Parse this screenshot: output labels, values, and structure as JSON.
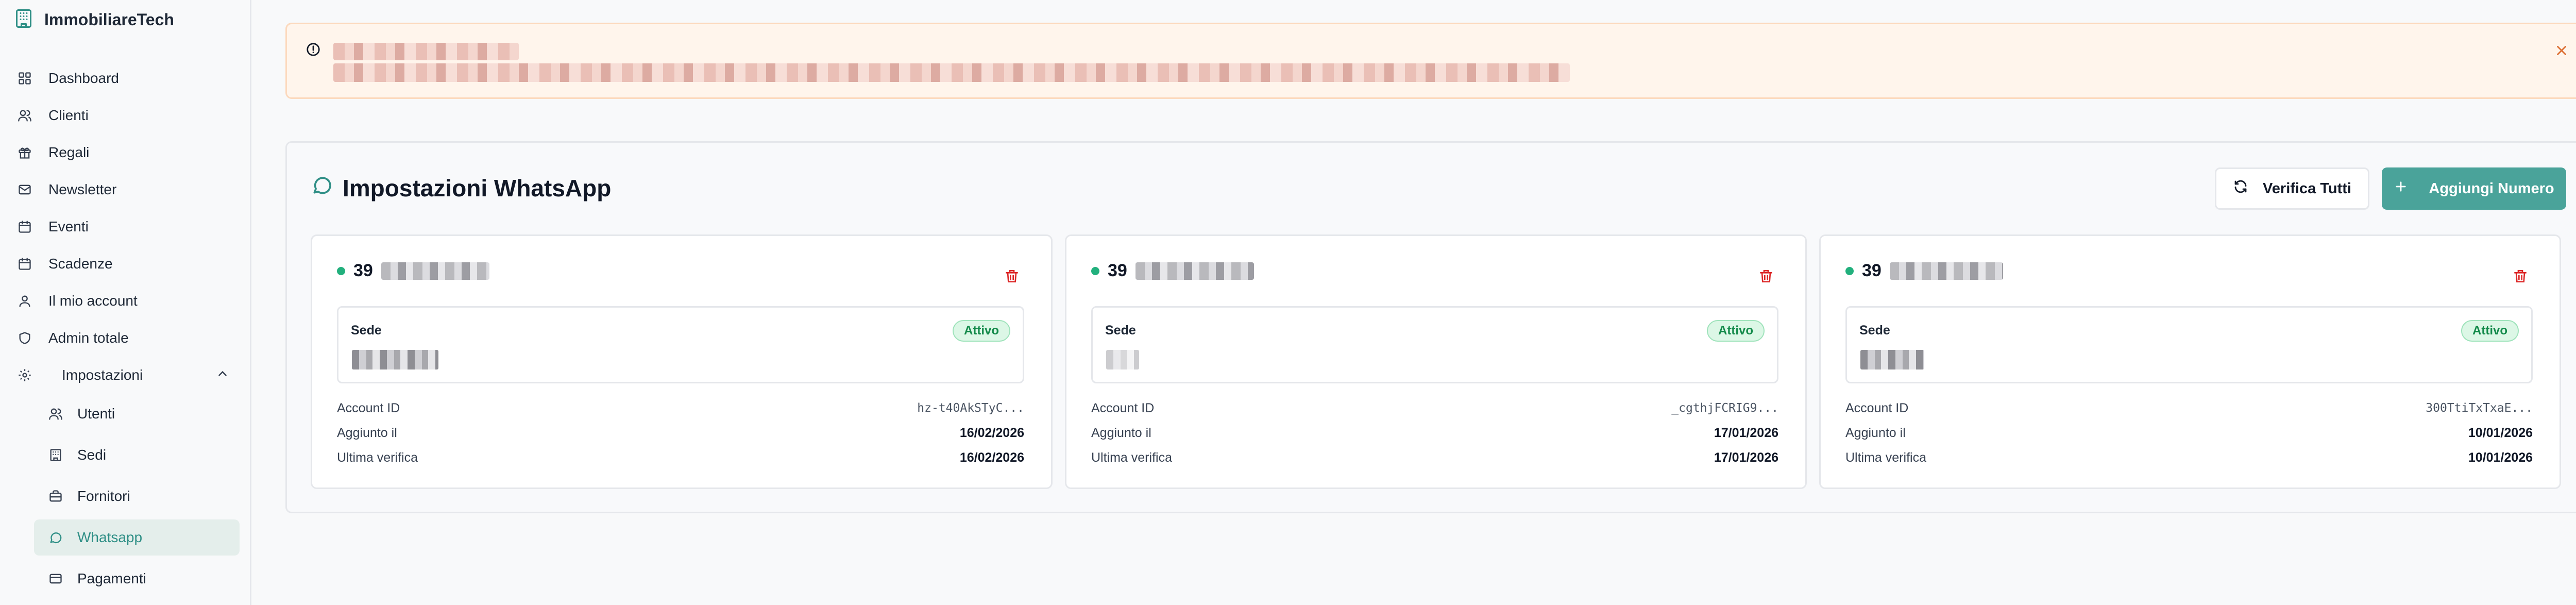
{
  "brand": {
    "name": "ImmobiliareTech",
    "logo_icon": "building-icon"
  },
  "sidebar": {
    "items": [
      {
        "label": "Dashboard",
        "icon": "grid-icon"
      },
      {
        "label": "Clienti",
        "icon": "users-icon"
      },
      {
        "label": "Regali",
        "icon": "gift-icon"
      },
      {
        "label": "Newsletter",
        "icon": "mail-icon"
      },
      {
        "label": "Eventi",
        "icon": "calendar-icon"
      },
      {
        "label": "Scadenze",
        "icon": "calendar-icon"
      },
      {
        "label": "Il mio account",
        "icon": "user-icon"
      },
      {
        "label": "Admin totale",
        "icon": "shield-icon"
      }
    ],
    "group": {
      "label": "Impostazioni",
      "icon": "gear-icon",
      "expanded": true,
      "children": [
        {
          "label": "Utenti",
          "icon": "users-icon"
        },
        {
          "label": "Sedi",
          "icon": "building-icon"
        },
        {
          "label": "Fornitori",
          "icon": "briefcase-icon"
        },
        {
          "label": "Whatsapp",
          "icon": "message-circle-icon",
          "active": true
        },
        {
          "label": "Pagamenti",
          "icon": "credit-card-icon"
        }
      ]
    }
  },
  "alert": {
    "icon": "alert-circle-icon",
    "close_icon": "close-icon"
  },
  "whatsapp": {
    "title": "Impostazioni WhatsApp",
    "verify_all_label": "Verifica Tutti",
    "add_number_label": "Aggiungi Numero",
    "sede_label": "Sede",
    "account_id_label": "Account ID",
    "added_label": "Aggiunto il",
    "last_check_label": "Ultima verifica",
    "accounts": [
      {
        "phone_prefix": "39",
        "status": "Attivo",
        "account_id": "hz-t40AkSTyC...",
        "added": "16/02/2026",
        "last_check": "16/02/2026"
      },
      {
        "phone_prefix": "39",
        "status": "Attivo",
        "account_id": "_cgthjFCRIG9...",
        "added": "17/01/2026",
        "last_check": "17/01/2026"
      },
      {
        "phone_prefix": "39",
        "status": "Attivo",
        "account_id": "300TtiTxTxaE...",
        "added": "10/01/2026",
        "last_check": "10/01/2026"
      }
    ]
  },
  "colors": {
    "accent": "#4aa39a",
    "active_bg": "#e4eeeb",
    "status_green": "#22b07d",
    "danger": "#dc2626",
    "alert_bg": "#fff5ec"
  }
}
